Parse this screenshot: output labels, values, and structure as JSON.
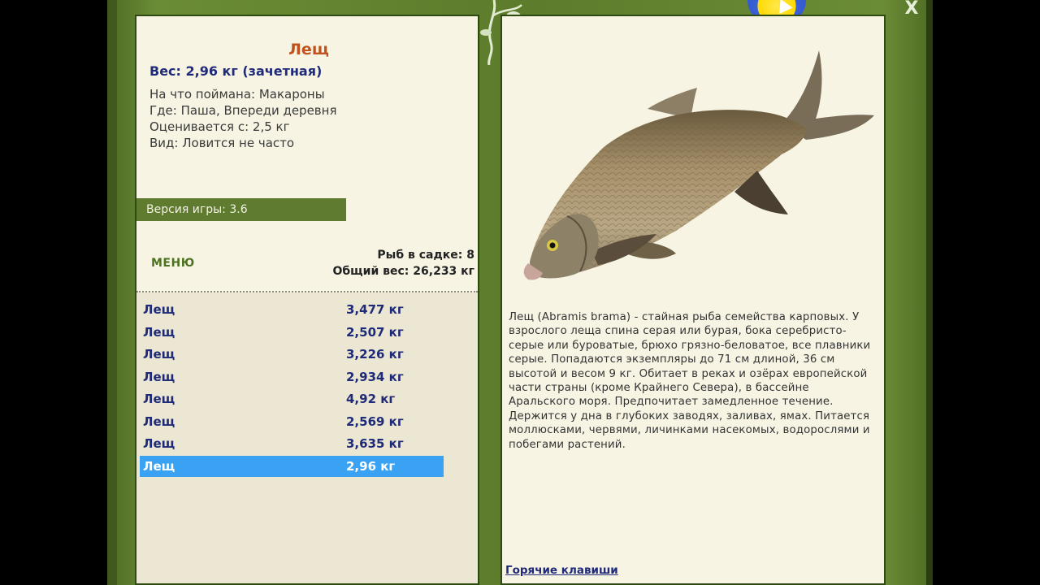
{
  "window": {
    "close_glyph": "X",
    "colors": {
      "frame_green": "#5e7d2e",
      "panel_bg": "#f7f4e4",
      "title_orange": "#c0521e",
      "list_blue": "#1f2a78",
      "selection_blue": "#39a2f2"
    }
  },
  "fish": {
    "name": "Лещ",
    "weight_line": "Вес: 2,96 кг (зачетная)",
    "bait_line": "На что поймана: Макароны",
    "location_line": "Где: Паша, Впереди деревня",
    "rated_line": "Оценивается с: 2,5 кг",
    "kind_line": "Вид: Ловится не часто"
  },
  "version": {
    "label": "Версия игры: 3.6"
  },
  "menu": {
    "label": "МЕНЮ"
  },
  "summary": {
    "fish_count": "Рыб в садке: 8",
    "total_weight": "Общий вес: 26,233 кг"
  },
  "catch_list": [
    {
      "name": "Лещ",
      "weight": "3,477 кг"
    },
    {
      "name": "Лещ",
      "weight": "2,507 кг"
    },
    {
      "name": "Лещ",
      "weight": "3,226 кг"
    },
    {
      "name": "Лещ",
      "weight": "2,934 кг"
    },
    {
      "name": "Лещ",
      "weight": "4,92 кг"
    },
    {
      "name": "Лещ",
      "weight": "2,569 кг"
    },
    {
      "name": "Лещ",
      "weight": "3,635 кг"
    },
    {
      "name": "Лещ",
      "weight": "2,96 кг",
      "selected": true
    }
  ],
  "description": {
    "text": "Лещ (Abramis brama) - стайная рыба семейства карповых. У взрослого леща спина серая или бурая, бока серебристо-серые или буроватые, брюхо грязно-беловатое, все плавники серые. Попадаются экземпляры до 71 см длиной, 36 см высотой и весом 9 кг. Обитает в реках и озёрах европейской части страны (кроме Крайнего Севера), в бассейне Аральского моря. Предпочитает замедленное течение. Держится у дна в глубоких заводях, заливах, ямах. Питается моллюсками, червями, личинками насекомых, водорослями и побегами растений."
  },
  "hotkeys": {
    "label": "Горячие клавиши"
  },
  "icons": [
    "close-icon",
    "vine-decoration-icon",
    "bream-fish-image",
    "mouse-cursor-icon"
  ]
}
